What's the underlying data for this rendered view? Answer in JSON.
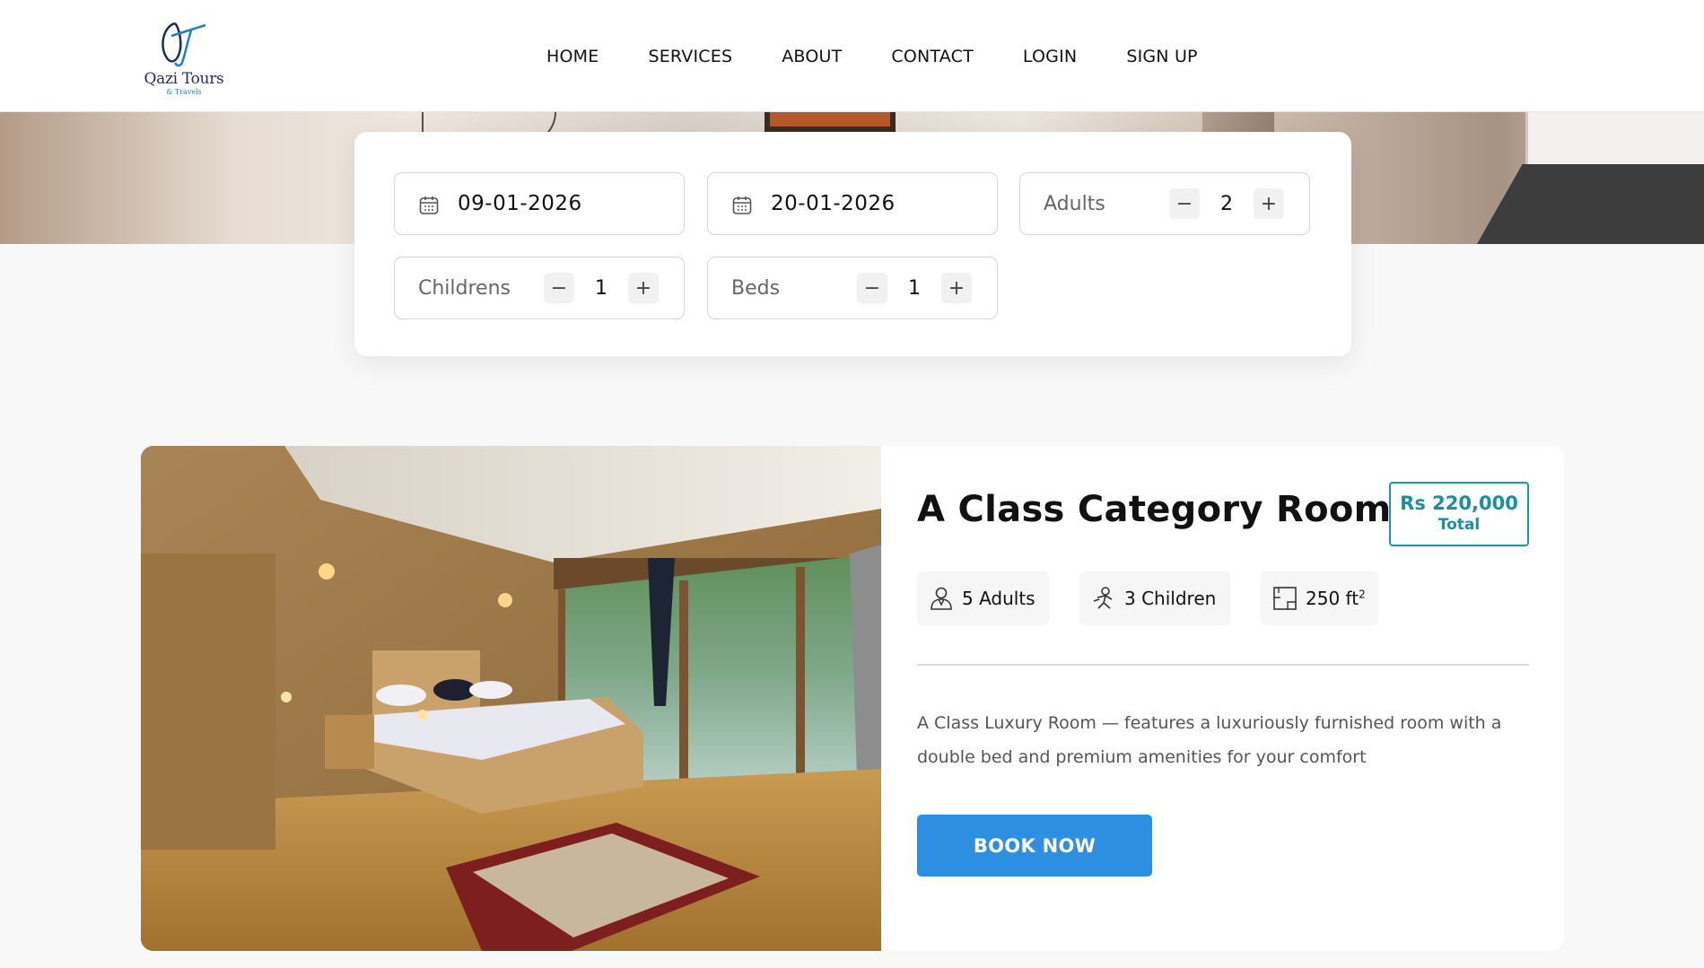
{
  "header": {
    "logo": {
      "name": "Qazi Tours",
      "sub": "& Travels"
    },
    "nav": [
      "HOME",
      "SERVICES",
      "ABOUT",
      "CONTACT",
      "LOGIN",
      "SIGN UP"
    ]
  },
  "booking": {
    "check_in": "09-01-2026",
    "check_out": "20-01-2026",
    "adults": {
      "label": "Adults",
      "value": "2"
    },
    "childrens": {
      "label": "Childrens",
      "value": "1"
    },
    "beds": {
      "label": "Beds",
      "value": "1"
    },
    "minus_symbol": "−",
    "plus_symbol": "+"
  },
  "room": {
    "title": "A Class Category Room",
    "price": "Rs 220,000",
    "price_label": "Total",
    "features": {
      "adults": "5 Adults",
      "children": "3 Children",
      "area": "250 ft",
      "area_exp": "2"
    },
    "description": "A Class Luxury Room — features a luxuriously furnished room with a double bed and premium amenities for your comfort",
    "book_label": "BOOK NOW"
  },
  "colors": {
    "accent": "#2c8fe0",
    "teal": "#1b8ea0",
    "logo_navy": "#1f2d55"
  }
}
